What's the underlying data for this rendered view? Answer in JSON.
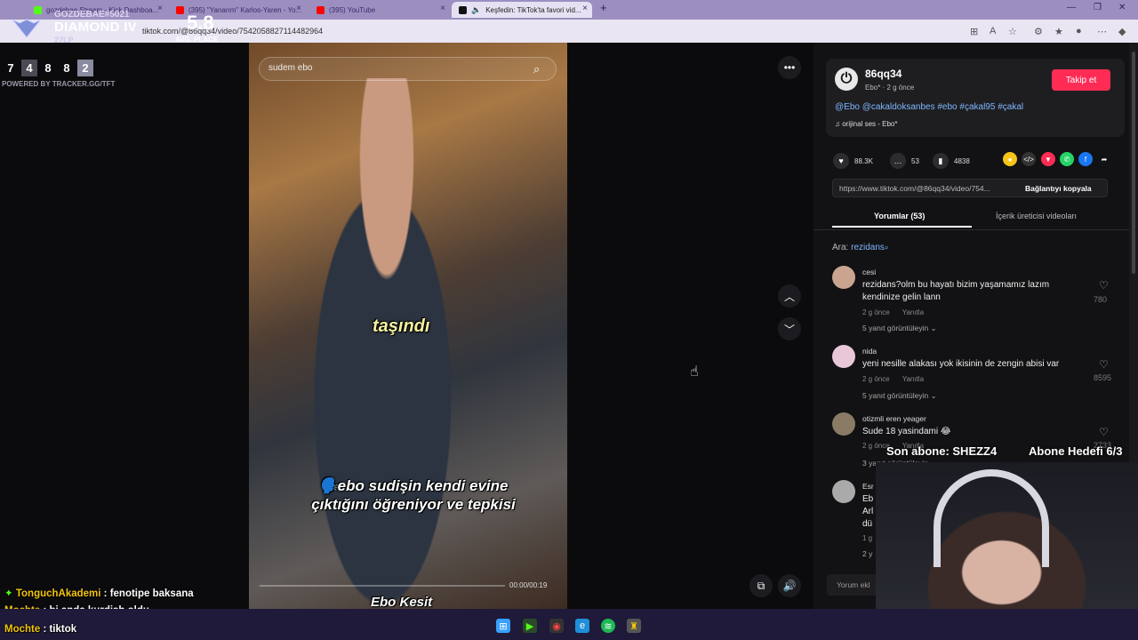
{
  "browser": {
    "tabs": [
      {
        "label": "gozdebae Stream - Kick Dashboa...",
        "favicon_color": "#53fc18"
      },
      {
        "label": "(395) \"Yanarım\" Karlos-Yaren - Yo...",
        "favicon_color": "#ff0000"
      },
      {
        "label": "(395) YouTube",
        "favicon_color": "#ff0000"
      },
      {
        "label": "Keşfedin: TikTok'ta favori vid...",
        "favicon_color": "#111111"
      }
    ],
    "url": "tiktok.com/@86qq34/video/7542058827114482964"
  },
  "overlay": {
    "player_tag": "GOZDEBAE#5021",
    "rank": "DIAMOND IV",
    "lp": "27LP",
    "avg_place_value": "5.8",
    "avg_place_label": "AVG. PLACE",
    "recent_places": [
      "7",
      "4",
      "8",
      "8",
      "2"
    ],
    "powered_by": "POWERED BY TRACKER.GG/TFT",
    "last_sub": "Son abone: SHEZZ4",
    "sub_goal": "Abone Hedefi 6/3"
  },
  "video": {
    "search_text": "sudem ebo",
    "caption_main": "taşındı",
    "caption_lines": [
      "🗣️ebo sudişin kendi evine",
      "çıktığını öğreniyor ve tepkisi"
    ],
    "caption_bottom": "Ebo Kesit",
    "time": "00:00/00:19"
  },
  "post": {
    "username": "86qq34",
    "meta": "Ebo* · 2 g önce",
    "follow_label": "Takip et",
    "description": "@Ebo @cakaldoksanbes #ebo #çakal95 #çakal",
    "sound": "orijinal ses - Ebo*",
    "likes": "88.3K",
    "comments": "53",
    "saves": "4838",
    "link": "https://www.tiktok.com/@86qq34/video/754...",
    "copy_label": "Bağlantıyı kopyala",
    "tab_comments": "Yorumlar (53)",
    "tab_creator": "İçerik üreticisi videoları",
    "search_label": "Ara:",
    "search_term": "rezidans",
    "comment_input": "Yorum ekl"
  },
  "comments": [
    {
      "name": "cesi",
      "text": "rezidans?olm bu hayatı bizim yaşamamız lazım kendinize gelin lann",
      "time": "2 g önce",
      "reply": "Yanıtla",
      "replies": "5 yanıt görüntüleyin ⌄",
      "likes": "780"
    },
    {
      "name": "nida",
      "text": "yeni nesille alakası yok ikisinin de zengin abisi var",
      "time": "2 g önce",
      "reply": "Yanıtla",
      "replies": "5 yanıt görüntüleyin ⌄",
      "likes": "8595"
    },
    {
      "name": "otizmli eren yeager",
      "text": "Sude 18 yasindami 😂",
      "time": "2 g önce",
      "reply": "Yanıtla",
      "replies": "3 yanıt görüntüleyin",
      "likes": "2733"
    },
    {
      "name": "Esr",
      "text": "Eb Arl dü",
      "time": "1 g",
      "reply": "",
      "replies": "2 y",
      "likes": ""
    }
  ],
  "chat": [
    {
      "user": "TonguchAkademi",
      "msg": " : fenotipe baksana"
    },
    {
      "user": "Mochte",
      "msg": " : bi anda kurdish oldu"
    },
    {
      "user": "Mochte",
      "msg": " : tiktok"
    }
  ]
}
